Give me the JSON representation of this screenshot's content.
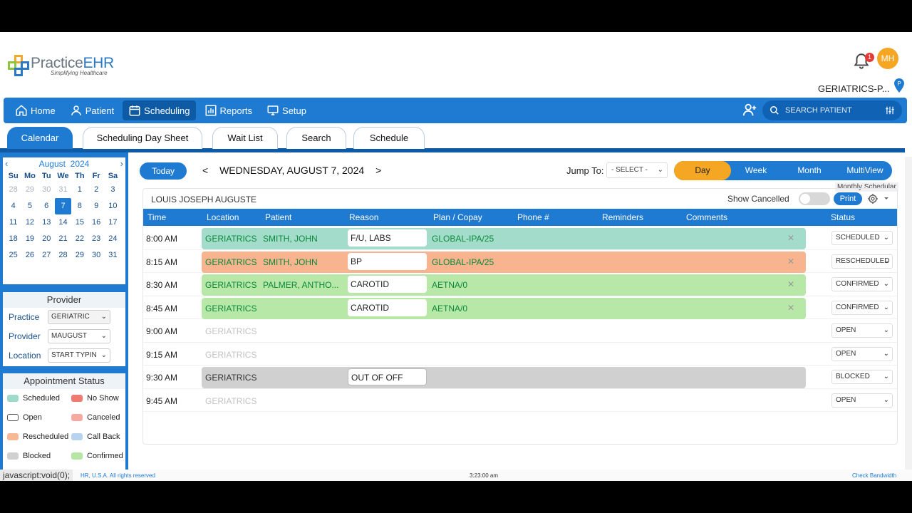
{
  "brand": {
    "name_light": "Practice",
    "name_bold": "EHR",
    "tagline": "Simplifying Healthcare"
  },
  "header": {
    "notification_count": "1",
    "avatar_initials": "MH",
    "practice_name": "GERIATRICS-P..."
  },
  "nav": {
    "items": [
      {
        "label": "Home",
        "icon": "home-icon"
      },
      {
        "label": "Patient",
        "icon": "user-icon"
      },
      {
        "label": "Scheduling",
        "icon": "calendar-icon",
        "active": true
      },
      {
        "label": "Reports",
        "icon": "chart-icon"
      },
      {
        "label": "Setup",
        "icon": "monitor-icon"
      }
    ],
    "search_placeholder": "SEARCH PATIENT"
  },
  "tabs": [
    {
      "label": "Calendar",
      "active": true
    },
    {
      "label": "Scheduling Day Sheet"
    },
    {
      "label": "Wait List"
    },
    {
      "label": "Search"
    },
    {
      "label": "Schedule"
    }
  ],
  "mini_calendar": {
    "month": "August",
    "year": "2024",
    "weekdays": [
      "Su",
      "Mo",
      "Tu",
      "We",
      "Th",
      "Fr",
      "Sa"
    ],
    "days": [
      [
        "28",
        "29",
        "30",
        "31",
        "1",
        "2",
        "3"
      ],
      [
        "4",
        "5",
        "6",
        "7",
        "8",
        "9",
        "10"
      ],
      [
        "11",
        "12",
        "13",
        "14",
        "15",
        "16",
        "17"
      ],
      [
        "18",
        "19",
        "20",
        "21",
        "22",
        "23",
        "24"
      ],
      [
        "25",
        "26",
        "27",
        "28",
        "29",
        "30",
        "31"
      ]
    ],
    "selected": "7"
  },
  "provider_panel": {
    "title": "Provider",
    "practice_label": "Practice",
    "practice_value": "GERIATRIC",
    "provider_label": "Provider",
    "provider_value": "MAUGUST",
    "location_label": "Location",
    "location_value": "START TYPIN"
  },
  "status_legend": {
    "title": "Appointment Status",
    "items": [
      {
        "label": "Scheduled",
        "color": "#9fd9c9"
      },
      {
        "label": "No Show",
        "color": "#ef7a6f"
      },
      {
        "label": "Open",
        "color": "#ffffff"
      },
      {
        "label": "Canceled",
        "color": "#f5a9a0"
      },
      {
        "label": "Rescheduled",
        "color": "#f7b894"
      },
      {
        "label": "Call Back",
        "color": "#b7d3ee"
      },
      {
        "label": "Blocked",
        "color": "#d0d0d0"
      },
      {
        "label": "Confirmed",
        "color": "#b6e6a6"
      }
    ]
  },
  "toolbar": {
    "today": "Today",
    "date": "WEDNESDAY, AUGUST 7, 2024",
    "prev": "<",
    "next": ">",
    "jump_label": "Jump To:",
    "jump_value": "- SELECT -",
    "views": [
      "Day",
      "Week",
      "Month",
      "MultiView"
    ],
    "active_view": "Day",
    "tooltip": "Monthly Schedular"
  },
  "schedule": {
    "provider_name": "LOUIS JOSEPH AUGUSTE",
    "show_cancelled": "Show Cancelled",
    "print": "Print",
    "columns": [
      "Time",
      "Location",
      "Patient",
      "Reason",
      "Plan / Copay",
      "Phone #",
      "Reminders",
      "Comments",
      "Status"
    ],
    "rows": [
      {
        "time": "8:00 AM",
        "location": "GERIATRICS",
        "patient": "SMITH, JOHN",
        "reason": "F/U, LABS",
        "plan": "GLOBAL-IPA/25",
        "status": "SCHEDULED",
        "color": "#a3dccb"
      },
      {
        "time": "8:15 AM",
        "location": "GERIATRICS",
        "patient": "SMITH, JOHN",
        "reason": "BP",
        "plan": "GLOBAL-IPA/25",
        "status": "RESCHEDULED",
        "color": "#f7b48e"
      },
      {
        "time": "8:30 AM",
        "location": "GERIATRICS",
        "patient": "PALMER, ANTHO...",
        "reason": "CAROTID",
        "plan": "AETNA/0",
        "status": "CONFIRMED",
        "color": "#b8e8a8"
      },
      {
        "time": "8:45 AM",
        "location": "GERIATRICS",
        "patient": "",
        "reason": "CAROTID",
        "plan": "AETNA/0",
        "status": "CONFIRMED",
        "color": "#b8e8a8"
      },
      {
        "time": "9:00 AM",
        "location": "GERIATRICS",
        "patient": "",
        "reason": "",
        "plan": "",
        "status": "OPEN",
        "color": ""
      },
      {
        "time": "9:15 AM",
        "location": "GERIATRICS",
        "patient": "",
        "reason": "",
        "plan": "",
        "status": "OPEN",
        "color": ""
      },
      {
        "time": "9:30 AM",
        "location": "GERIATRICS",
        "patient": "",
        "reason": "OUT OF OFF",
        "plan": "",
        "status": "BLOCKED",
        "color": "#d0d0d0"
      },
      {
        "time": "9:45 AM",
        "location": "GERIATRICS",
        "patient": "",
        "reason": "",
        "plan": "",
        "status": "OPEN",
        "color": ""
      }
    ]
  },
  "footer": {
    "js": "javascript:void(0);",
    "copyright": "HR, U.S.A. All rights reserved",
    "clock": "3:23:00 am",
    "bandwidth": "Check Bandwidth"
  }
}
